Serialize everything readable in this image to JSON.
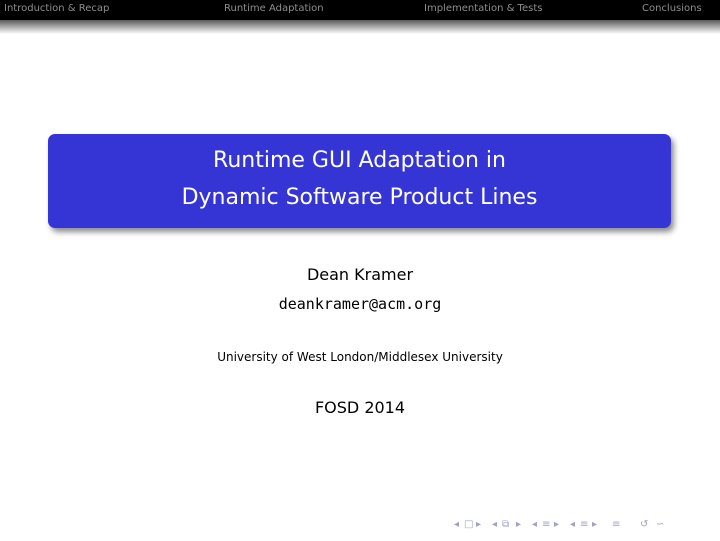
{
  "nav": {
    "sections": [
      "Introduction & Recap",
      "Runtime Adaptation",
      "Implementation & Tests",
      "Conclusions"
    ]
  },
  "title": {
    "line1": "Runtime GUI Adaptation in",
    "line2": "Dynamic Software Product Lines"
  },
  "author": "Dean Kramer",
  "email": "deankramer@acm.org",
  "institute": "University of West London/Middlesex University",
  "date": "FOSD 2014",
  "beamer_nav": {
    "icons": [
      "frame-prev-icon",
      "frame-icon",
      "frame-next-icon",
      "subsection-prev-icon",
      "subsection-icon",
      "subsection-next-icon",
      "section-prev-icon",
      "section-icon",
      "section-next-icon",
      "doc-prev-icon",
      "doc-icon",
      "doc-next-icon",
      "appendix-icon",
      "back-icon",
      "search-icon"
    ]
  }
}
